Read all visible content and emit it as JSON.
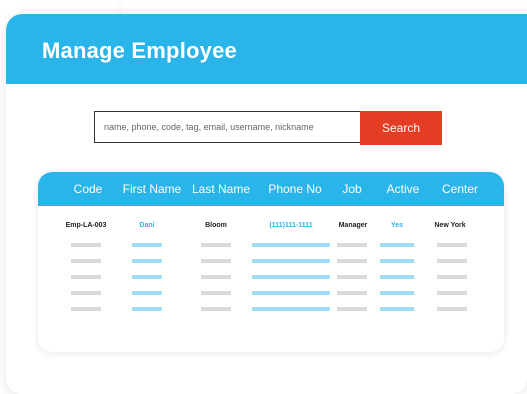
{
  "app": {
    "title": "Manage Employee"
  },
  "search": {
    "placeholder": "name, phone, code, tag, email, username, nickname",
    "button_label": "Search"
  },
  "table": {
    "columns": [
      "Code",
      "First Name",
      "Last Name",
      "Phone No",
      "Job",
      "Active",
      "Center"
    ],
    "rows": [
      {
        "code": "Emp-LA-003",
        "first_name": "Dani",
        "last_name": "Bloom",
        "phone": "(111)111-1111",
        "job": "Manager",
        "active": "Yes",
        "center": "New York"
      }
    ],
    "placeholder_row_count": 5
  },
  "colors": {
    "accent": "#29b4ea",
    "search_button": "#e43d23",
    "placeholder_gray": "#d9d9d9",
    "placeholder_blue": "#9fdcf3"
  }
}
